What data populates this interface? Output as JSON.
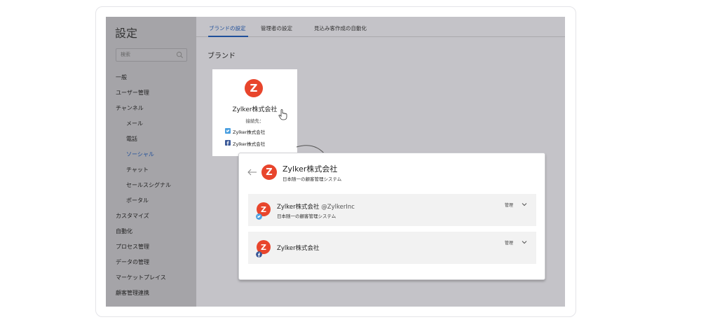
{
  "sidebar": {
    "title": "設定",
    "search_placeholder": "検索",
    "items": [
      {
        "label": "一般"
      },
      {
        "label": "ユーザー管理"
      },
      {
        "label": "チャンネル"
      },
      {
        "label": "メール"
      },
      {
        "label": "電話"
      },
      {
        "label": "ソーシャル"
      },
      {
        "label": "チャット"
      },
      {
        "label": "セールスシグナル"
      },
      {
        "label": "ポータル"
      },
      {
        "label": "カスタマイズ"
      },
      {
        "label": "自動化"
      },
      {
        "label": "プロセス管理"
      },
      {
        "label": "データの管理"
      },
      {
        "label": "マーケットプレイス"
      },
      {
        "label": "顧客管理連携"
      }
    ]
  },
  "tabs": [
    {
      "label": "ブランドの設定"
    },
    {
      "label": "管理者の設定"
    },
    {
      "label": "見込み客作成の自動化"
    }
  ],
  "section_title": "ブランド",
  "brand_card": {
    "logo_letter": "Z",
    "name": "Zylker株式会社",
    "destination_label": "接続先：",
    "twitter_account": "Zylker株式会社",
    "facebook_account": "Zylker株式会社"
  },
  "popup": {
    "logo_letter": "Z",
    "title": "Zylker株式会社",
    "subtitle": "日本随一の顧客管理システム",
    "accounts": [
      {
        "name": "Zylker株式会社",
        "handle": "@ZylkerInc",
        "description": "日本随一の顧客管理システム",
        "manage_label": "管理"
      },
      {
        "name": "Zylker株式会社",
        "handle": "",
        "description": "",
        "manage_label": "管理"
      }
    ]
  },
  "colors": {
    "brand_red": "#e8452c",
    "active_blue": "#1f4f9a",
    "twitter_blue": "#4a9fe0",
    "facebook_blue": "#3b5998"
  },
  "icons": [
    "search-icon",
    "hand-cursor-icon",
    "curved-arrow-icon",
    "back-arrow-icon",
    "twitter-icon",
    "facebook-icon",
    "chevron-down-icon"
  ]
}
